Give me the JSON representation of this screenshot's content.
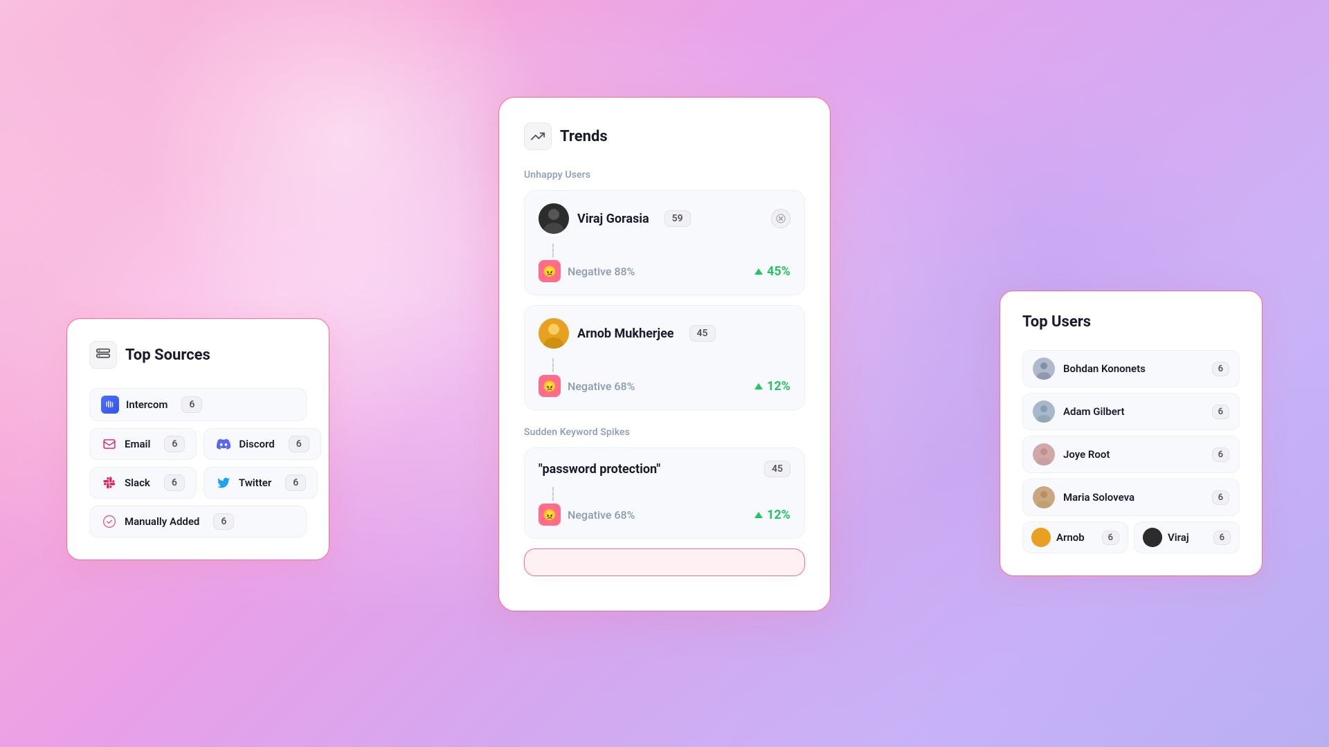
{
  "background": {
    "gradient_desc": "pink-purple swirl"
  },
  "left_card": {
    "title": "Top Sources",
    "icon": "database-icon",
    "sources": [
      {
        "name": "Intercom",
        "count": 6,
        "icon": "intercom-icon"
      },
      {
        "name": "Email",
        "count": 6,
        "icon": "email-icon"
      },
      {
        "name": "Discord",
        "count": 6,
        "icon": "discord-icon"
      },
      {
        "name": "Slack",
        "count": 6,
        "icon": "slack-icon"
      },
      {
        "name": "Twitter",
        "count": 6,
        "icon": "twitter-icon"
      },
      {
        "name": "Manually Added",
        "count": 6,
        "icon": "manually-added-icon"
      }
    ]
  },
  "center_card": {
    "title": "Trends",
    "icon": "trends-icon",
    "unhappy_users_label": "Unhappy Users",
    "users": [
      {
        "name": "Viraj Gorasia",
        "count": 59,
        "sentiment": "Negative 88%",
        "increase": "45%",
        "avatar_type": "dark"
      },
      {
        "name": "Arnob Mukherjee",
        "count": 45,
        "sentiment": "Negative 68%",
        "increase": "12%",
        "avatar_type": "amber"
      }
    ],
    "keyword_spikes_label": "Sudden Keyword Spikes",
    "keywords": [
      {
        "text": "\"password protection\"",
        "count": 45,
        "sentiment": "Negative 68%",
        "increase": "12%"
      }
    ]
  },
  "right_card": {
    "title": "Top Users",
    "users": [
      {
        "name": "Bohdan Kononets",
        "count": 6,
        "has_avatar": true
      },
      {
        "name": "Adam Gilbert",
        "count": 6,
        "has_avatar": true
      },
      {
        "name": "Joye Root",
        "count": 6,
        "has_avatar": true
      },
      {
        "name": "Maria Soloveva",
        "count": 6,
        "has_avatar": true
      },
      {
        "name": "Arnob",
        "count": 6,
        "has_avatar": false
      },
      {
        "name": "Viraj",
        "count": 6,
        "has_avatar": true
      }
    ]
  }
}
